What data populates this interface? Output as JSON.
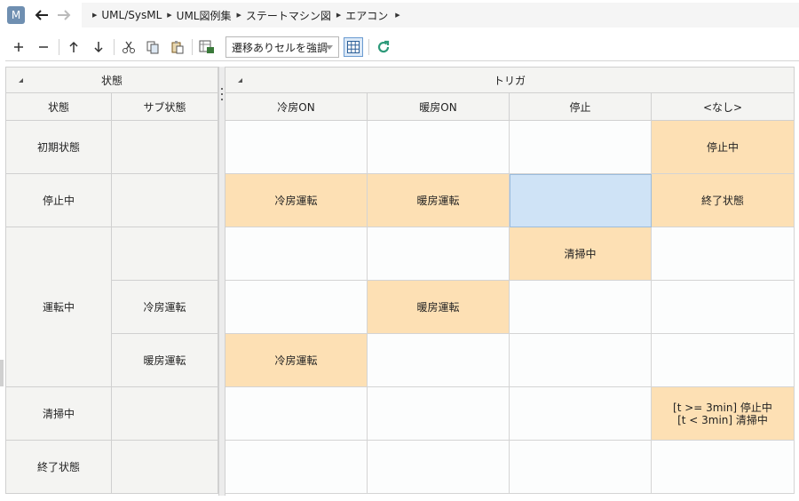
{
  "app": {
    "badge": "M"
  },
  "breadcrumb": [
    "UML/SysML",
    "UML図例集",
    "ステートマシン図",
    "エアコン"
  ],
  "toolbar": {
    "highlight_select": "遷移ありセルを強調"
  },
  "table": {
    "group_headers": {
      "state": "状態",
      "trigger": "トリガ"
    },
    "columns": {
      "state": "状態",
      "substate": "サブ状態",
      "triggers": [
        "冷房ON",
        "暖房ON",
        "停止",
        "<なし>"
      ]
    },
    "rows": [
      {
        "state": "初期状態",
        "substate": "",
        "cells": [
          "",
          "",
          "",
          "停止中"
        ]
      },
      {
        "state": "停止中",
        "substate": "",
        "cells": [
          "冷房運転",
          "暖房運転",
          "",
          "終了状態"
        ]
      },
      {
        "state": "運転中",
        "substate": "",
        "cells": [
          "",
          "",
          "清掃中",
          ""
        ]
      },
      {
        "state": "",
        "substate": "冷房運転",
        "cells": [
          "",
          "暖房運転",
          "",
          ""
        ]
      },
      {
        "state": "",
        "substate": "暖房運転",
        "cells": [
          "冷房運転",
          "",
          "",
          ""
        ]
      },
      {
        "state": "清掃中",
        "substate": "",
        "cells": [
          "",
          "",
          "",
          "[t >= 3min] 停止中\n[t < 3min] 清掃中"
        ]
      },
      {
        "state": "終了状態",
        "substate": "",
        "cells": [
          "",
          "",
          "",
          ""
        ]
      }
    ],
    "cell4_lines": [
      "[t >= 3min] 停止中",
      "[t < 3min] 清掃中"
    ]
  },
  "colors": {
    "highlight": "#fde0b4",
    "selected": "#cfe3f6",
    "header": "#f4f4f2",
    "badge": "#6f8fb1"
  }
}
